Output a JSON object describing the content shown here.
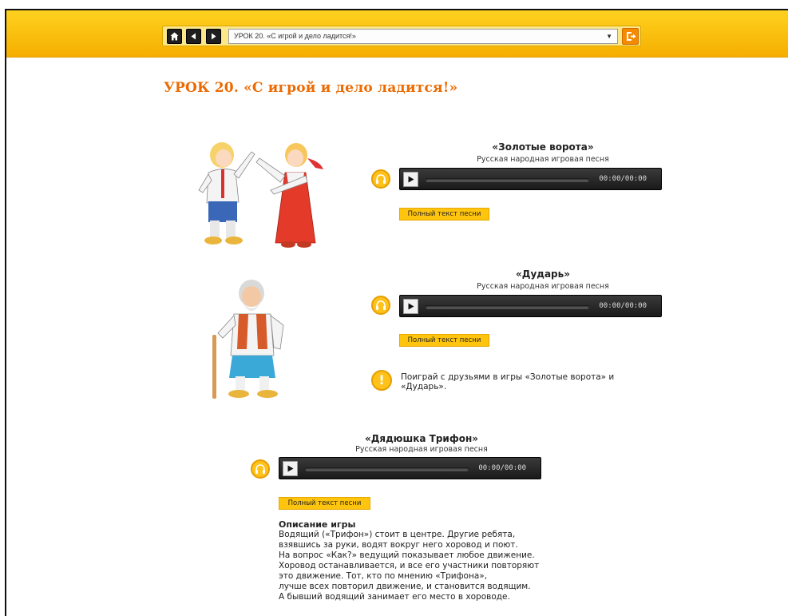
{
  "nav": {
    "home_icon": "home-icon",
    "prev_icon": "arrow-left-icon",
    "next_icon": "arrow-right-icon",
    "lesson_select_value": "УРОК 20. «С игрой и дело ладится!»",
    "exit_icon": "exit-icon"
  },
  "page_title": "УРОК 20.   «С игрой и дело ладится!»",
  "songs": [
    {
      "title": "«Золотые ворота»",
      "subtitle": "Русская народная игровая песня",
      "time": "00:00/00:00",
      "lyrics_button": "Полный текст песни"
    },
    {
      "title": "«Дударь»",
      "subtitle": "Русская народная игровая песня",
      "time": "00:00/00:00",
      "lyrics_button": "Полный текст песни"
    },
    {
      "title": "«Дядюшка Трифон»",
      "subtitle": "Русская народная игровая песня",
      "time": "00:00/00:00",
      "lyrics_button": "Полный текст песни"
    }
  ],
  "tip": {
    "icon": "exclamation-icon",
    "line1": "Поиграй с друзьями в игры «Золотые ворота» и",
    "line2": "«Дударь»."
  },
  "description": {
    "title": "Описание игры",
    "lines": [
      "Водящий («Трифон») стоит в центре. Другие ребята,",
      "взявшись за руки, водят вокруг него хоровод и поют.",
      "На вопрос «Как?» ведущий показывает любое движение.",
      "Хоровод останавливается, и все его участники повторяют",
      "это движение. Тот, кто по мнению «Трифона»,",
      "лучше всех повторил движение, и становится водящим.",
      "А бывший водящий занимает его место в хороводе."
    ]
  },
  "colors": {
    "accent": "#ffc40d",
    "title": "#ec6a00",
    "player_bg": "#1f1f1f"
  }
}
